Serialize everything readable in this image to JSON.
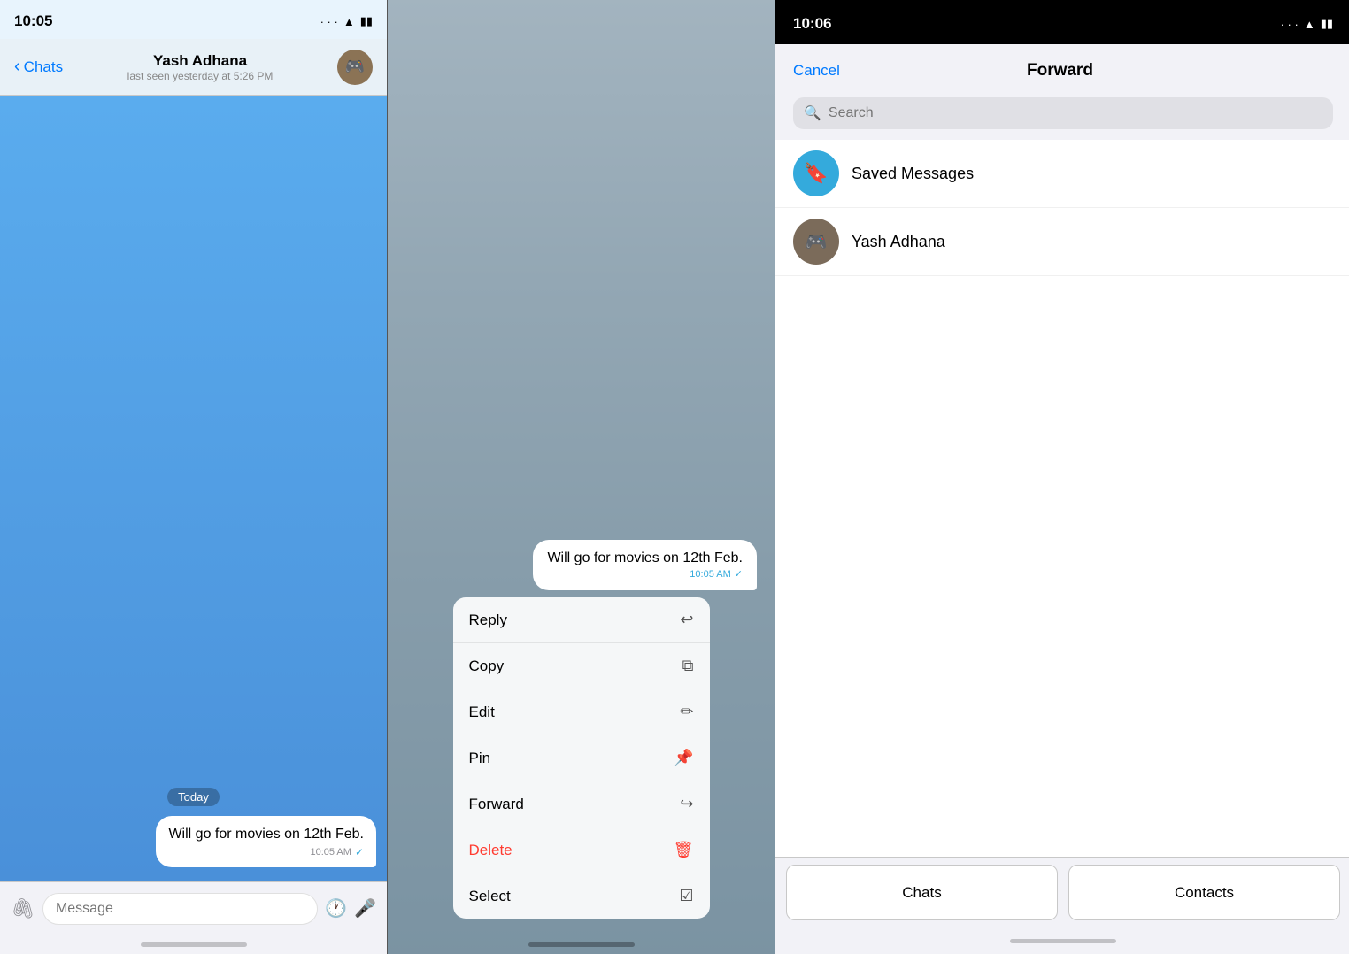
{
  "panel1": {
    "status_time": "10:05",
    "signal": "···",
    "wifi": "📶",
    "battery": "🔋",
    "back_label": "Chats",
    "contact_name": "Yash Adhana",
    "contact_status": "last seen yesterday at 5:26 PM",
    "avatar_emoji": "🎮",
    "chat_bg": "blue",
    "date_separator": "Today",
    "message_text": "Will go for movies on 12th Feb.",
    "message_time": "10:05 AM",
    "message_check": "✓",
    "input_placeholder": "Message",
    "attach_icon": "📎",
    "emoji_icon": "🕐",
    "mic_icon": "🎤"
  },
  "panel2": {
    "preview_text": "Will go for movies on 12th Feb.",
    "preview_time": "10:05 AM",
    "preview_check": "✓",
    "menu_items": [
      {
        "label": "Reply",
        "icon": "↩",
        "type": "normal"
      },
      {
        "label": "Copy",
        "icon": "📋",
        "type": "normal"
      },
      {
        "label": "Edit",
        "icon": "✏",
        "type": "normal"
      },
      {
        "label": "Pin",
        "icon": "📌",
        "type": "normal"
      },
      {
        "label": "Forward",
        "icon": "↪",
        "type": "normal"
      },
      {
        "label": "Delete",
        "icon": "🗑",
        "type": "delete"
      },
      {
        "label": "Select",
        "icon": "✅",
        "type": "normal"
      }
    ]
  },
  "panel3": {
    "status_time": "10:06",
    "signal": "···",
    "wifi": "📶",
    "battery": "🔋",
    "cancel_label": "Cancel",
    "title": "Forward",
    "search_placeholder": "Search",
    "contacts": [
      {
        "name": "Saved Messages",
        "avatar_type": "saved",
        "avatar_icon": "🔖"
      },
      {
        "name": "Yash Adhana",
        "avatar_type": "user",
        "avatar_icon": "🎮"
      }
    ],
    "tab_chats": "Chats",
    "tab_contacts": "Contacts"
  }
}
